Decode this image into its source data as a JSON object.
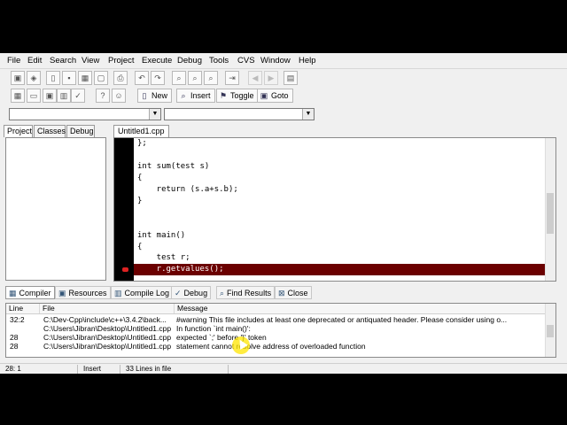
{
  "menu": [
    "File",
    "Edit",
    "Search",
    "View",
    "Project",
    "Execute",
    "Debug",
    "Tools",
    "CVS",
    "Window",
    "Help"
  ],
  "toolbar2": {
    "new": "New",
    "insert": "Insert",
    "toggle": "Toggle",
    "goto": "Goto"
  },
  "left_tabs": [
    "Project",
    "Classes",
    "Debug"
  ],
  "file_tab": "Untitled1.cpp",
  "code_lines": [
    "};",
    "",
    "int sum(test s)",
    "{",
    "    return (s.a+s.b);",
    "}",
    "",
    "",
    "int main()",
    "{",
    "    test r;"
  ],
  "error_line": "    r.getvalues();",
  "bottom_tabs": [
    "Compiler",
    "Resources",
    "Compile Log",
    "Debug",
    "Find Results",
    "Close"
  ],
  "messages": {
    "headers": [
      "Line",
      "File",
      "Message"
    ],
    "rows": [
      [
        "32:2",
        "C:\\Dev-Cpp\\include\\c++\\3.4.2\\back...",
        "#warning This file includes at least one deprecated or antiquated header. Please consider using o..."
      ],
      [
        "",
        "C:\\Users\\Jibran\\Desktop\\Untitled1.cpp",
        "In function `int main()':"
      ],
      [
        "28",
        "C:\\Users\\Jibran\\Desktop\\Untitled1.cpp",
        "expected `;' before '}' token"
      ],
      [
        "28",
        "C:\\Users\\Jibran\\Desktop\\Untitled1.cpp",
        "statement cannot resolve address of overloaded function"
      ]
    ]
  },
  "status": {
    "pos": "28: 1",
    "mode": "Insert",
    "lines": "33 Lines in file"
  }
}
